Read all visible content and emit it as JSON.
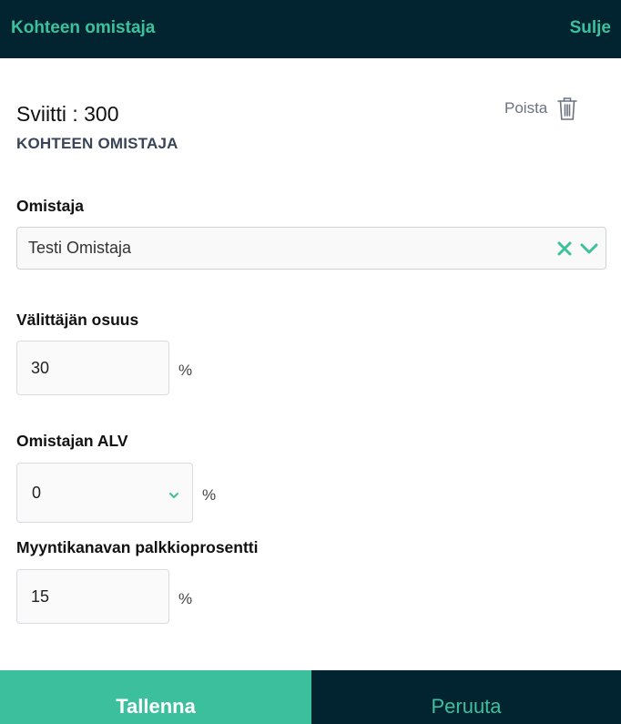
{
  "header": {
    "title": "Kohteen omistaja",
    "close_label": "Sulje"
  },
  "unit": {
    "title": "Sviitti : 300",
    "section_heading": "KOHTEEN OMISTAJA"
  },
  "delete": {
    "label": "Poista",
    "icon": "trash-icon"
  },
  "owner": {
    "label": "Omistaja",
    "selected": "Testi Omistaja",
    "clear_icon": "close-icon",
    "dropdown_icon": "chevron-down-icon"
  },
  "broker_share": {
    "label": "Välittäjän osuus",
    "value": "30",
    "unit": "%"
  },
  "owner_vat": {
    "label": "Omistajan ALV",
    "selected": "0",
    "unit": "%",
    "dropdown_icon": "chevron-down-icon"
  },
  "channel_commission": {
    "label": "Myyntikanavan palkkioprosentti",
    "value": "15",
    "unit": "%"
  },
  "footer": {
    "save_label": "Tallenna",
    "cancel_label": "Peruuta"
  },
  "colors": {
    "header_bg": "#022330",
    "accent": "#3cc19c",
    "save_bg": "#3cbf9c"
  }
}
